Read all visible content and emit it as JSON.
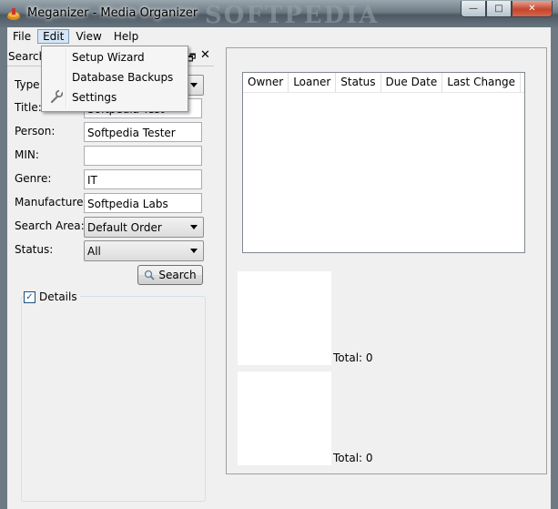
{
  "window": {
    "title": "Meganizer - Media Organizer",
    "watermark": "SOFTPEDIA",
    "controls": {
      "minimize": "—",
      "maximize": "□",
      "close": "✕"
    }
  },
  "menubar": {
    "items": [
      "File",
      "Edit",
      "View",
      "Help"
    ],
    "active": "Edit"
  },
  "edit_menu": {
    "items": [
      "Setup Wizard",
      "Database Backups",
      "Settings"
    ]
  },
  "left_panel": {
    "header": "Search",
    "fields": {
      "type": {
        "label": "Type:"
      },
      "title": {
        "label": "Title:",
        "value": "Softpedia Test"
      },
      "person": {
        "label": "Person:",
        "value": "Softpedia Tester"
      },
      "min": {
        "label": "MIN:",
        "value": ""
      },
      "genre": {
        "label": "Genre:",
        "value": "IT"
      },
      "manufacturer": {
        "label": "Manufacturer:",
        "value": "Softpedia Labs"
      },
      "search_area": {
        "label": "Search Area:",
        "value": "Default Order"
      },
      "status": {
        "label": "Status:",
        "value": "All"
      }
    },
    "search_button": "Search",
    "details": {
      "label": "Details",
      "checked": true
    }
  },
  "right_panel": {
    "table_columns": [
      "Owner",
      "Loaner",
      "Status",
      "Due Date",
      "Last Change"
    ],
    "totals": [
      "Total: 0",
      "Total: 0"
    ]
  },
  "colors": {
    "menu_highlight": "#d6e6f5",
    "close_button": "#c4452c"
  }
}
